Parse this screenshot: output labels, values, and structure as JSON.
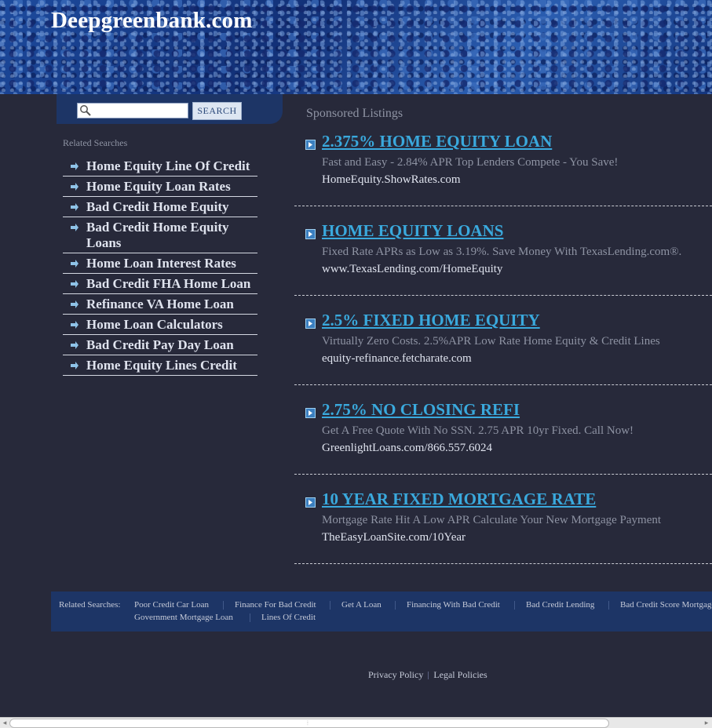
{
  "header": {
    "site_title": "Deepgreenbank.com"
  },
  "search": {
    "placeholder": "",
    "value": "",
    "button_label": "SEARCH"
  },
  "related": {
    "label": "Related Searches",
    "items": [
      {
        "label": "Home Equity Line Of Credit"
      },
      {
        "label": "Home Equity Loan Rates"
      },
      {
        "label": "Bad Credit Home Equity"
      },
      {
        "label": "Bad Credit Home Equity Loans"
      },
      {
        "label": "Home Loan Interest Rates"
      },
      {
        "label": "Bad Credit FHA Home Loan"
      },
      {
        "label": "Refinance VA Home Loan"
      },
      {
        "label": "Home Loan Calculators"
      },
      {
        "label": "Bad Credit Pay Day Loan"
      },
      {
        "label": "Home Equity Lines Credit"
      }
    ]
  },
  "sponsored": {
    "title": "Sponsored Listings",
    "ads": [
      {
        "title": "2.375% HOME EQUITY LOAN",
        "desc": "Fast and Easy - 2.84% APR Top Lenders Compete - You Save!",
        "url": "HomeEquity.ShowRates.com"
      },
      {
        "title": "HOME EQUITY LOANS",
        "desc": "Fixed Rate APRs as Low as 3.19%. Save Money With TexasLending.com®.",
        "url": "www.TexasLending.com/HomeEquity"
      },
      {
        "title": "2.5% FIXED HOME EQUITY",
        "desc": "Virtually Zero Costs. 2.5%APR Low Rate Home Equity & Credit Lines",
        "url": "equity-refinance.fetcharate.com"
      },
      {
        "title": "2.75% NO CLOSING REFI",
        "desc": "Get A Free Quote With No SSN. 2.75 APR 10yr Fixed. Call Now!",
        "url": "GreenlightLoans.com/866.557.6024"
      },
      {
        "title": "10 YEAR FIXED MORTGAGE RATE",
        "desc": "Mortgage Rate Hit A Low APR Calculate Your New Mortgage Payment",
        "url": "TheEasyLoanSite.com/10Year"
      }
    ]
  },
  "footer": {
    "label": "Related Searches:",
    "links": [
      "Poor Credit Car Loan",
      "Finance For Bad Credit",
      "Get A Loan",
      "Financing With Bad Credit",
      "Bad Credit Lending",
      "Bad Credit Score Mortgage",
      "Government Mortgage Loan",
      "Lines Of Credit"
    ]
  },
  "bottom_links": {
    "privacy": "Privacy Policy",
    "legal": "Legal Policies"
  },
  "colors": {
    "background": "#27293a",
    "header_blue": "#143a85",
    "panel_blue": "#1d3566",
    "link_blue": "#3aa9dd",
    "muted_text": "#8e93a3",
    "light_text": "#dfe3ee"
  },
  "icons": {
    "search": "magnifier-icon",
    "related_bullet": "arrow-bullet-icon",
    "ad_bullet": "arrow-box-icon"
  }
}
